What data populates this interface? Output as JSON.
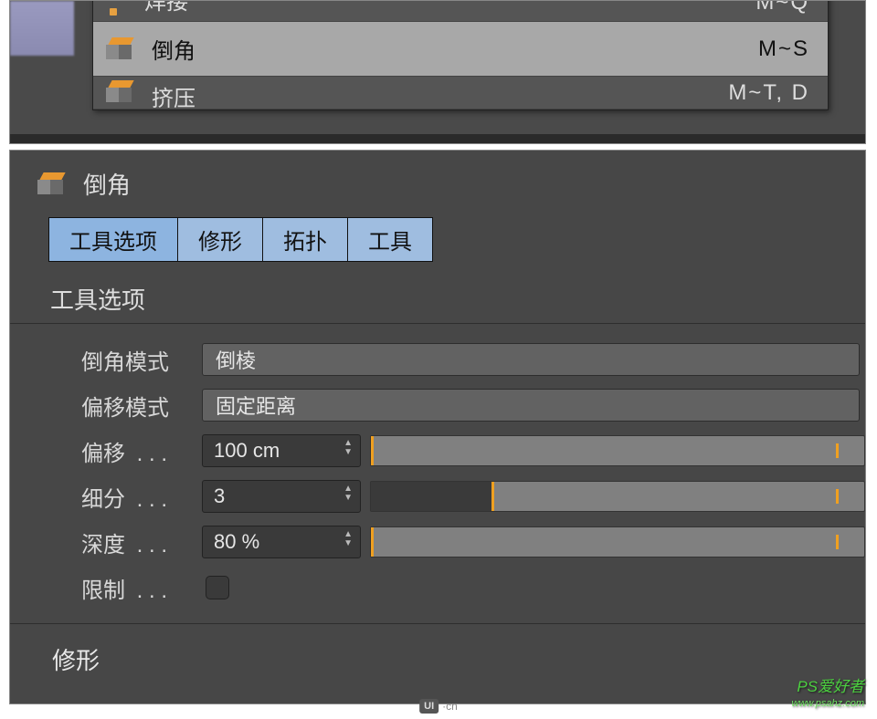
{
  "menu": {
    "items": [
      {
        "label": "焊接",
        "shortcut": "M~Q",
        "style": "dot"
      },
      {
        "label": "倒角",
        "shortcut": "M~S",
        "style": "cube",
        "selected": true
      },
      {
        "label": "挤压",
        "shortcut": "M~T, D",
        "style": "cube"
      }
    ]
  },
  "panel": {
    "title": "倒角",
    "tabs": [
      {
        "label": "工具选项",
        "active": true
      },
      {
        "label": "修形"
      },
      {
        "label": "拓扑"
      },
      {
        "label": "工具"
      }
    ],
    "section_header": "工具选项",
    "rows": {
      "bevel_mode": {
        "label": "倒角模式",
        "value": "倒棱"
      },
      "offset_mode": {
        "label": "偏移模式",
        "value": "固定距离"
      },
      "offset": {
        "label": "偏移",
        "dots": ". . .",
        "value": "100 cm",
        "slider_pct": 0
      },
      "subdiv": {
        "label": "细分",
        "dots": ". . .",
        "value": "3",
        "slider_pct": 25
      },
      "depth": {
        "label": "深度",
        "dots": ". . .",
        "value": "80 %",
        "slider_pct": 0
      },
      "limit": {
        "label": "限制",
        "dots": ". . .",
        "checked": false
      }
    },
    "section_footer": "修形"
  },
  "watermark": {
    "ui_badge": "UI",
    "ui_suffix": "·cn",
    "ps_line1": "PS爱好者",
    "ps_line2": "www.psahz.com"
  }
}
